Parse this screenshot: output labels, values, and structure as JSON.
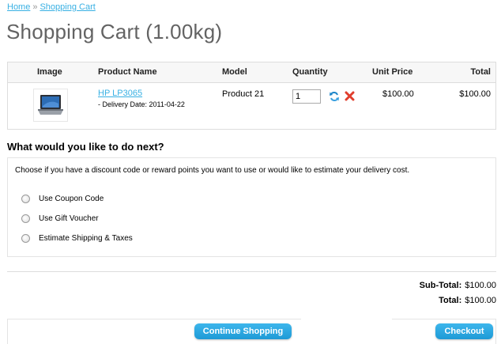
{
  "breadcrumb": {
    "home": "Home",
    "separator": "»",
    "current": "Shopping Cart"
  },
  "page_title": "Shopping Cart  (1.00kg)",
  "cart": {
    "headers": {
      "image": "Image",
      "name": "Product Name",
      "model": "Model",
      "quantity": "Quantity",
      "unit_price": "Unit Price",
      "total": "Total"
    },
    "items": [
      {
        "name": "HP LP3065",
        "delivery": "- Delivery Date: 2011-04-22",
        "model": "Product 21",
        "quantity": "1",
        "unit_price": "$100.00",
        "total": "$100.00"
      }
    ]
  },
  "next_section": {
    "title": "What would you like to do next?",
    "intro": "Choose if you have a discount code or reward points you want to use or would like to estimate your delivery cost.",
    "options": [
      "Use Coupon Code",
      "Use Gift Voucher",
      "Estimate Shipping & Taxes"
    ]
  },
  "totals": {
    "subtotal_label": "Sub-Total:",
    "subtotal_value": "$100.00",
    "total_label": "Total:",
    "total_value": "$100.00"
  },
  "buttons": {
    "continue": "Continue Shopping",
    "checkout": "Checkout"
  },
  "colors": {
    "link": "#38B0E3",
    "button": "#1E9AD6",
    "title": "#636363",
    "remove": "#E03E2D"
  },
  "icons": {
    "update": "refresh-icon",
    "remove": "remove-x-icon",
    "thumbnail": "laptop-thumbnail"
  }
}
